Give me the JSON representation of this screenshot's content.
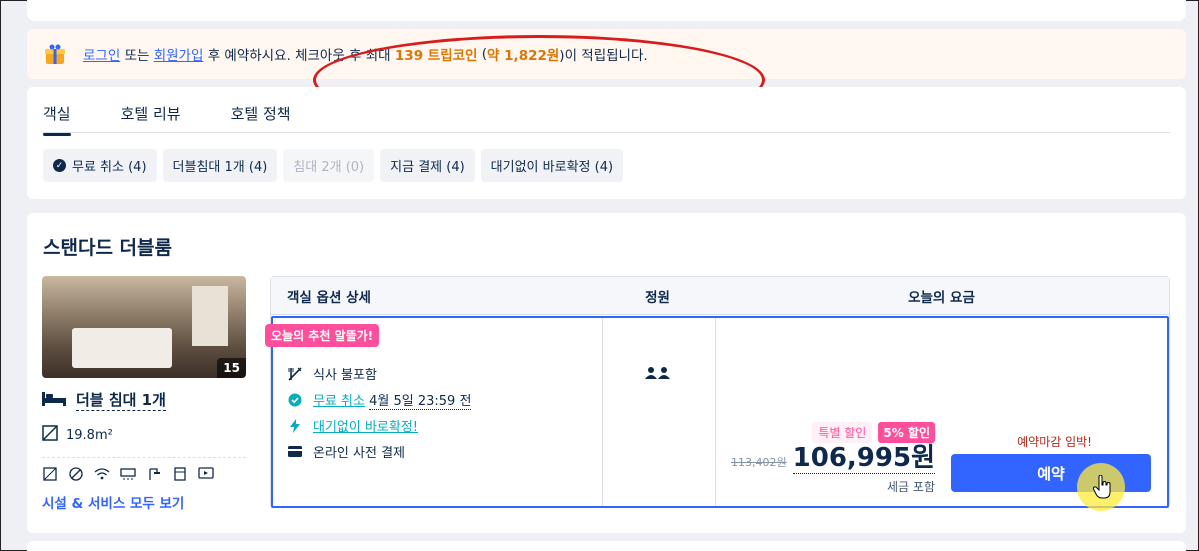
{
  "promo": {
    "login": "로그인",
    "or": "또는",
    "signup": "회원가입",
    "text_a": "후 예약하시요. 체크아웃 후 최대",
    "coin": "139 트립코인",
    "krw_open": "(",
    "krw": "약 1,822원",
    "text_b": ")이 적립됩니다."
  },
  "tabs": [
    "객실",
    "호텔 리뷰",
    "호텔 정책"
  ],
  "filters": [
    {
      "label": "무료 취소 (4)",
      "checked": true,
      "disabled": false
    },
    {
      "label": "더블침대 1개 (4)",
      "checked": false,
      "disabled": false
    },
    {
      "label": "침대 2개 (0)",
      "checked": false,
      "disabled": true
    },
    {
      "label": "지금 결제 (4)",
      "checked": false,
      "disabled": false
    },
    {
      "label": "대기없이 바로확정 (4)",
      "checked": false,
      "disabled": false
    }
  ],
  "room": {
    "title": "스탠다드 더블룸",
    "photo_count": "15",
    "bed": "더블 침대 1개",
    "size": "19.8m²",
    "see_all": "시설 & 서비스 모두 보기",
    "amenity_icons": [
      "room-size-icon",
      "no-smoking-icon",
      "wifi-icon",
      "aircon-icon",
      "shower-icon",
      "fridge-icon",
      "tv-icon"
    ]
  },
  "table": {
    "col_option": "객실 옵션 상세",
    "col_capacity": "정원",
    "col_price": "오늘의 요금",
    "badge": "오늘의 추천 알뜰가!",
    "meal": "식사 불포함",
    "cancel": "무료 취소",
    "cancel_date": "4월 5일 23:59 전",
    "instant": "대기없이 바로확정!",
    "payment": "온라인 사전 결제",
    "discount_label": "특별 할인",
    "discount_pct": "5% 할인",
    "old_price": "113,402원",
    "new_price": "106,995원",
    "tax": "세금 포함",
    "urgent": "예약마감 임박!",
    "book": "예약"
  },
  "colors": {
    "accent": "#3264ff",
    "pink": "#ff4e9b",
    "orange": "#d97706",
    "teal": "#06aebd",
    "red_annotation": "#d61c1c"
  }
}
